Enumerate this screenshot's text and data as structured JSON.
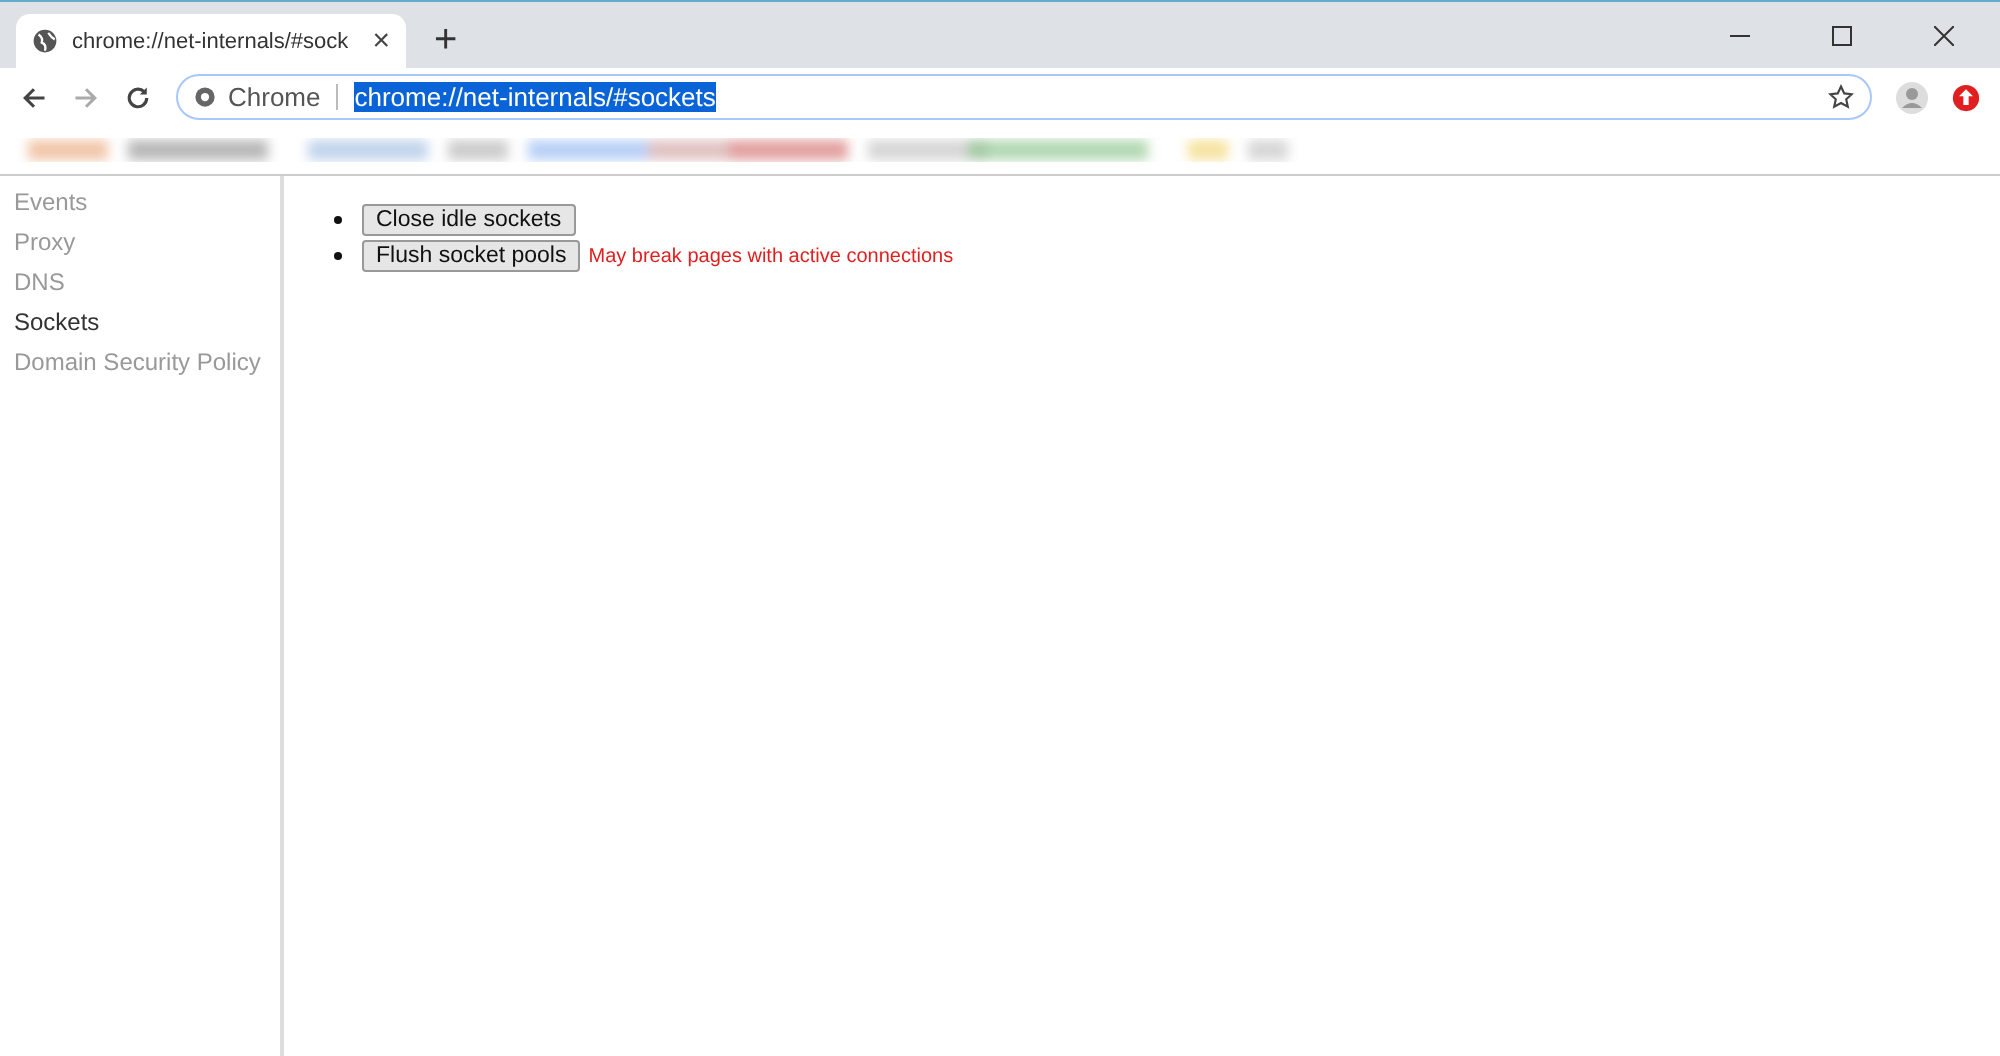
{
  "tab": {
    "title": "chrome://net-internals/#sock",
    "close": "×",
    "new_tab": "+"
  },
  "address_bar": {
    "origin_label": "Chrome",
    "url": "chrome://net-internals/#sockets",
    "url_selected": true
  },
  "sidebar": {
    "items": [
      {
        "label": "Events",
        "selected": false
      },
      {
        "label": "Proxy",
        "selected": false
      },
      {
        "label": "DNS",
        "selected": false
      },
      {
        "label": "Sockets",
        "selected": true
      },
      {
        "label": "Domain Security Policy",
        "selected": false
      }
    ]
  },
  "actions": [
    {
      "button": "Close idle sockets"
    },
    {
      "button": "Flush socket pools",
      "warning": "May break pages with active connections"
    }
  ]
}
